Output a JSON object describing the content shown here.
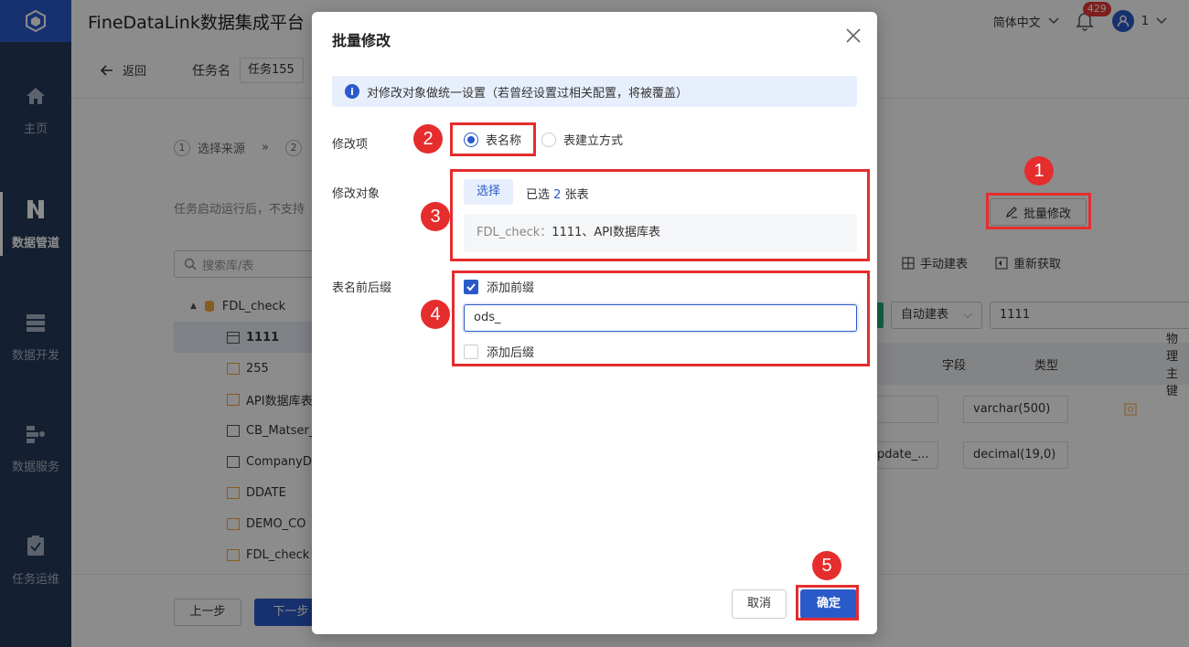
{
  "app": {
    "title": "FineDataLink数据集成平台"
  },
  "topbar": {
    "language": "简体中文",
    "notification_count": "429",
    "user": "1"
  },
  "sidebar": {
    "items": [
      {
        "label": "主页",
        "icon": "home-icon"
      },
      {
        "label": "数据管道",
        "icon": "pipeline-icon",
        "active": true
      },
      {
        "label": "数据开发",
        "icon": "database-icon"
      },
      {
        "label": "数据服务",
        "icon": "service-icon"
      },
      {
        "label": "任务运维",
        "icon": "clipboard-icon"
      }
    ]
  },
  "page": {
    "back_label": "返回",
    "task_name_label": "任务名",
    "task_name_value": "任务155",
    "steps": [
      {
        "num": "1",
        "label": "选择来源"
      },
      {
        "num": "2",
        "label": ""
      }
    ],
    "hint": "任务启动运行后，不支持",
    "search_placeholder": "搜索库/表",
    "tree": {
      "root": "FDL_check",
      "items": [
        "1111",
        "255",
        "API数据库表",
        "CB_Matser_",
        "CompanyDi",
        "DDATE",
        "DEMO_CO",
        "FDL_check"
      ]
    },
    "batch_edit_label": "批量修改",
    "manual_create_label": "手动建表",
    "refetch_label": "重新获取",
    "create_mode_select": "自动建表",
    "table_name_value": "1111",
    "table_headers": {
      "field": "字段",
      "type": "类型",
      "pk": "物理主键"
    },
    "rows": [
      {
        "field": "",
        "type": "varchar(500)"
      },
      {
        "field": "pdate_...",
        "type": "decimal(19,0)"
      }
    ],
    "prev_label": "上一步",
    "next_label": "下一步"
  },
  "modal": {
    "title": "批量修改",
    "info": "对修改对象做统一设置（若曾经设置过相关配置，将被覆盖）",
    "field_edit_item": "修改项",
    "radio_table_name": "表名称",
    "radio_create_mode": "表建立方式",
    "field_target": "修改对象",
    "select_button": "选择",
    "selected_prefix": "已选",
    "selected_count": "2",
    "selected_suffix": "张表",
    "target_db": "FDL_check：",
    "target_tables": "1111、API数据库表",
    "field_affix": "表名前后缀",
    "add_prefix_label": "添加前缀",
    "prefix_value": "ods_",
    "add_suffix_label": "添加后缀",
    "cancel_label": "取消",
    "ok_label": "确定"
  },
  "annotations": [
    "1",
    "2",
    "3",
    "4",
    "5"
  ],
  "colors": {
    "accent": "#2a5ac9",
    "annotation": "#e52d2d",
    "sidebar": "#263a59"
  }
}
